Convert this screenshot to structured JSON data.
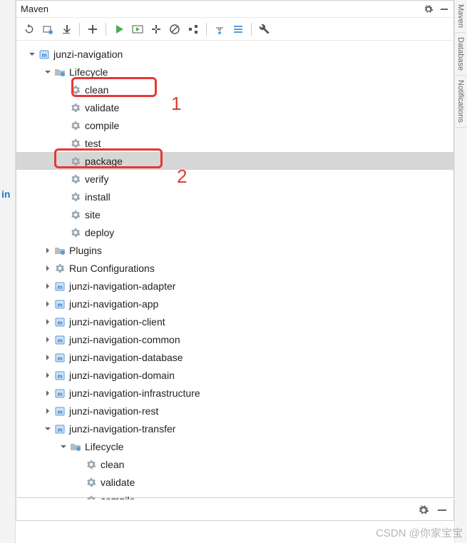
{
  "panel": {
    "title": "Maven"
  },
  "tree": [
    {
      "depth": 0,
      "expander": "down",
      "icon": "maven",
      "label": "junzi-navigation",
      "name": "project-junzi-navigation"
    },
    {
      "depth": 1,
      "expander": "down",
      "icon": "folder",
      "label": "Lifecycle",
      "name": "lifecycle-folder"
    },
    {
      "depth": 2,
      "expander": "none",
      "icon": "gear",
      "label": "clean",
      "name": "goal-clean",
      "box": 1
    },
    {
      "depth": 2,
      "expander": "none",
      "icon": "gear",
      "label": "validate",
      "name": "goal-validate"
    },
    {
      "depth": 2,
      "expander": "none",
      "icon": "gear",
      "label": "compile",
      "name": "goal-compile"
    },
    {
      "depth": 2,
      "expander": "none",
      "icon": "gear",
      "label": "test",
      "name": "goal-test"
    },
    {
      "depth": 2,
      "expander": "none",
      "icon": "gear",
      "label": "package",
      "name": "goal-package",
      "selected": true,
      "box": 2
    },
    {
      "depth": 2,
      "expander": "none",
      "icon": "gear",
      "label": "verify",
      "name": "goal-verify"
    },
    {
      "depth": 2,
      "expander": "none",
      "icon": "gear",
      "label": "install",
      "name": "goal-install"
    },
    {
      "depth": 2,
      "expander": "none",
      "icon": "gear",
      "label": "site",
      "name": "goal-site"
    },
    {
      "depth": 2,
      "expander": "none",
      "icon": "gear",
      "label": "deploy",
      "name": "goal-deploy"
    },
    {
      "depth": 1,
      "expander": "right",
      "icon": "folder",
      "label": "Plugins",
      "name": "plugins-folder"
    },
    {
      "depth": 1,
      "expander": "right",
      "icon": "gear",
      "label": "Run Configurations",
      "name": "run-configurations"
    },
    {
      "depth": 1,
      "expander": "right",
      "icon": "maven",
      "label": "junzi-navigation-adapter",
      "name": "module-adapter"
    },
    {
      "depth": 1,
      "expander": "right",
      "icon": "maven",
      "label": "junzi-navigation-app",
      "name": "module-app"
    },
    {
      "depth": 1,
      "expander": "right",
      "icon": "maven",
      "label": "junzi-navigation-client",
      "name": "module-client"
    },
    {
      "depth": 1,
      "expander": "right",
      "icon": "maven",
      "label": "junzi-navigation-common",
      "name": "module-common"
    },
    {
      "depth": 1,
      "expander": "right",
      "icon": "maven",
      "label": "junzi-navigation-database",
      "name": "module-database"
    },
    {
      "depth": 1,
      "expander": "right",
      "icon": "maven",
      "label": "junzi-navigation-domain",
      "name": "module-domain"
    },
    {
      "depth": 1,
      "expander": "right",
      "icon": "maven",
      "label": "junzi-navigation-infrastructure",
      "name": "module-infrastructure"
    },
    {
      "depth": 1,
      "expander": "right",
      "icon": "maven",
      "label": "junzi-navigation-rest",
      "name": "module-rest"
    },
    {
      "depth": 1,
      "expander": "down",
      "icon": "maven",
      "label": "junzi-navigation-transfer",
      "name": "module-transfer"
    },
    {
      "depth": 2,
      "expander": "down",
      "icon": "folder",
      "label": "Lifecycle",
      "name": "lifecycle-folder-2"
    },
    {
      "depth": 3,
      "expander": "none",
      "icon": "gear",
      "label": "clean",
      "name": "goal-clean-2"
    },
    {
      "depth": 3,
      "expander": "none",
      "icon": "gear",
      "label": "validate",
      "name": "goal-validate-2"
    },
    {
      "depth": 3,
      "expander": "none",
      "icon": "gear",
      "label": "compile",
      "name": "goal-compile-2"
    }
  ],
  "annotations": {
    "1": "1",
    "2": "2"
  },
  "right_tabs": [
    "Maven",
    "Database",
    "Notifications"
  ],
  "watermark": "CSDN @你家宝宝"
}
